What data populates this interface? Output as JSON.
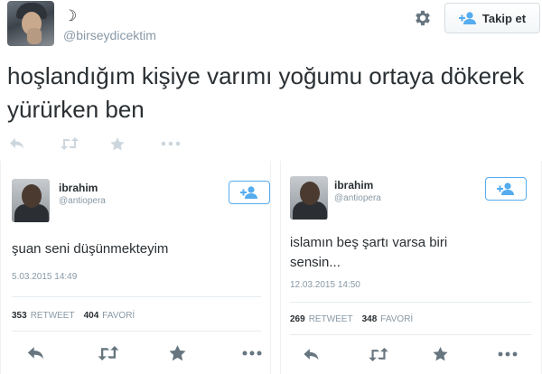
{
  "main_tweet": {
    "user_name": "☽",
    "user_handle": "@birseydicektim",
    "follow_label": "Takip et",
    "text": "hoşlandığım kişiye varımı yoğumu ortaya dökerek yürürken ben",
    "icons": [
      "reply-icon",
      "retweet-icon",
      "favorite-icon",
      "more-icon",
      "gear-icon",
      "add-user-icon"
    ]
  },
  "embedded_tweets": [
    {
      "user_name": "ibrahim",
      "user_handle": "@antiopera",
      "text": "şuan seni düşünmekteyim",
      "date": "5.03.2015 14:49",
      "retweet_count": "353",
      "retweet_label": "RETWEET",
      "favorite_count": "404",
      "favorite_label": "FAVORİ"
    },
    {
      "user_name": "ibrahim",
      "user_handle": "@antiopera",
      "text": "islamın beş şartı varsa biri sensin...",
      "date": "12.03.2015 14:50",
      "retweet_count": "269",
      "retweet_label": "RETWEET",
      "favorite_count": "348",
      "favorite_label": "FAVORİ"
    }
  ],
  "colors": {
    "text": "#292f33",
    "muted": "#8899a6",
    "icon": "#ccd6dd",
    "icon_dark": "#66757f",
    "accent": "#55acee"
  }
}
